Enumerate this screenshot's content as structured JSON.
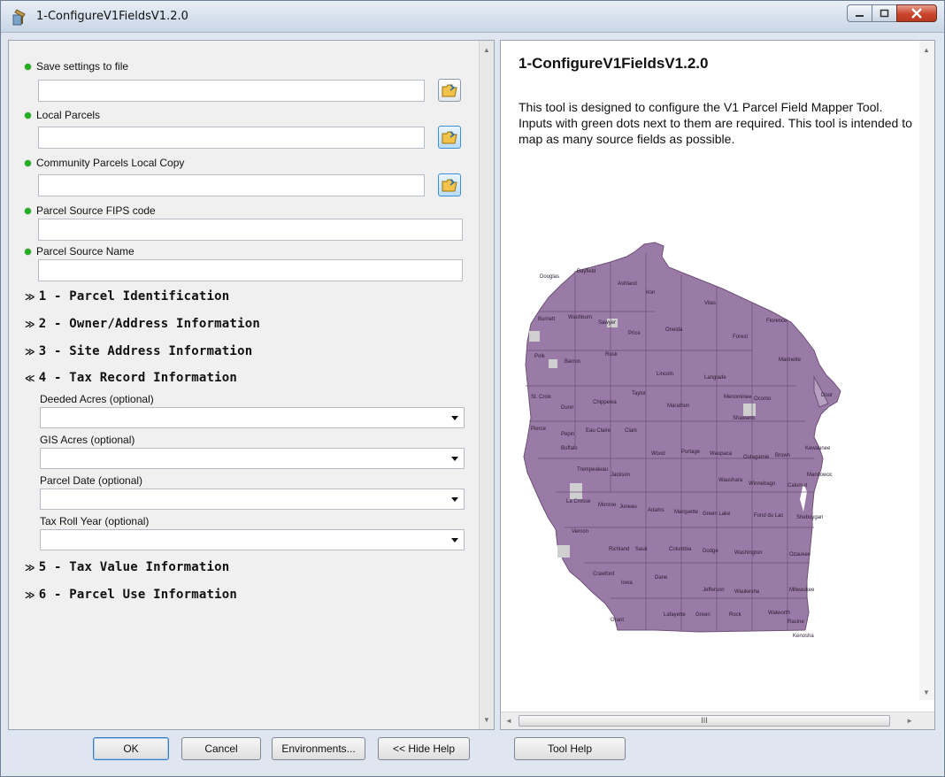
{
  "window": {
    "title": "1-ConfigureV1FieldsV1.2.0"
  },
  "params": {
    "save_settings": {
      "label": "Save settings to file",
      "value": ""
    },
    "local_parcels": {
      "label": "Local Parcels",
      "value": ""
    },
    "community_parcels": {
      "label": "Community Parcels Local Copy",
      "value": ""
    },
    "fips_code": {
      "label": "Parcel Source FIPS code",
      "value": ""
    },
    "source_name": {
      "label": "Parcel Source Name",
      "value": ""
    }
  },
  "sections": [
    {
      "label": "1 - Parcel Identification",
      "chevron": "≫"
    },
    {
      "label": "2 - Owner/Address Information",
      "chevron": "≫"
    },
    {
      "label": "3 - Site Address Information",
      "chevron": "≫"
    },
    {
      "label": "4 - Tax Record Information",
      "chevron": "≪"
    },
    {
      "label": "5 - Tax Value Information",
      "chevron": "≫"
    },
    {
      "label": "6 - Parcel Use Information",
      "chevron": "≫"
    }
  ],
  "tax_record_fields": [
    {
      "label": "Deeded Acres (optional)",
      "value": ""
    },
    {
      "label": "GIS Acres (optional)",
      "value": ""
    },
    {
      "label": "Parcel Date (optional)",
      "value": ""
    },
    {
      "label": "Tax Roll Year (optional)",
      "value": ""
    }
  ],
  "help": {
    "title": "1-ConfigureV1FieldsV1.2.0",
    "body": "This tool is designed to configure the V1 Parcel Field Mapper Tool. Inputs with green dots next to them are required. This tool is intended to map as many source fields as possible.",
    "scroll_grip": "III"
  },
  "map": {
    "fill": "#9a7aa6",
    "counties": [
      "Douglas",
      "Bayfield",
      "Ashland",
      "Iron",
      "Vilas",
      "Florence",
      "Burnett",
      "Washburn",
      "Sawyer",
      "Price",
      "Oneida",
      "Forest",
      "Marinette",
      "Polk",
      "Barron",
      "Rusk",
      "Lincoln",
      "Langlade",
      "Taylor",
      "St. Croix",
      "Dunn",
      "Chippewa",
      "Marathon",
      "Menominee",
      "Oconto",
      "Door",
      "Pierce",
      "Pepin",
      "Eau Claire",
      "Clark",
      "Shawano",
      "Buffalo",
      "Wood",
      "Portage",
      "Waupaca",
      "Outagamie",
      "Brown",
      "Kewaunee",
      "Jackson",
      "Trempealeau",
      "Waushara",
      "Winnebago",
      "Calumet",
      "Manitowoc",
      "La Crosse",
      "Monroe",
      "Juneau",
      "Adams",
      "Marquette",
      "Green Lake",
      "Fond du Lac",
      "Sheboygan",
      "Vernon",
      "Richland",
      "Sauk",
      "Columbia",
      "Dodge",
      "Washington",
      "Ozaukee",
      "Crawford",
      "Iowa",
      "Dane",
      "Jefferson",
      "Waukesha",
      "Milwaukee",
      "Grant",
      "Lafayette",
      "Green",
      "Rock",
      "Walworth",
      "Racine",
      "Kenosha"
    ]
  },
  "buttons": {
    "ok": "OK",
    "cancel": "Cancel",
    "environments": "Environments...",
    "hide_help": "<< Hide Help",
    "tool_help": "Tool Help"
  }
}
